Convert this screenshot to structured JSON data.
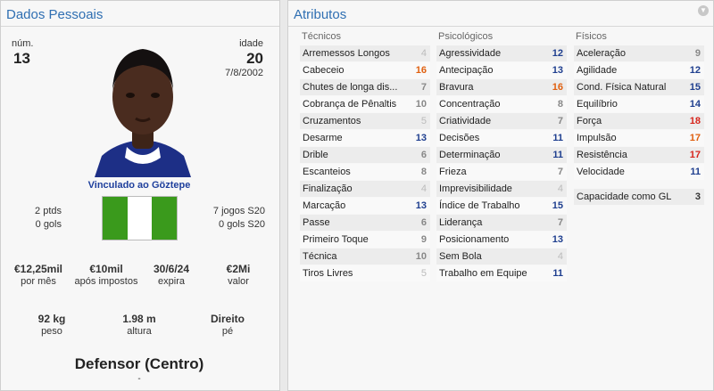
{
  "left": {
    "title": "Dados Pessoais",
    "num_label": "núm.",
    "num_value": "13",
    "age_label": "idade",
    "age_value": "20",
    "dob": "7/8/2002",
    "club_link": "Vinculado ao Göztepe",
    "stats_left": [
      "2 ptds",
      "0 gols"
    ],
    "stats_right": [
      "7 jogos S20",
      "0 gols S20"
    ],
    "contract": [
      {
        "value": "€12,25mil",
        "label": "por mês"
      },
      {
        "value": "€10mil",
        "label": "após impostos"
      },
      {
        "value": "30/6/24",
        "label": "expira"
      },
      {
        "value": "€2Mi",
        "label": "valor"
      }
    ],
    "physical": [
      {
        "value": "92 kg",
        "label": "peso"
      },
      {
        "value": "1.98 m",
        "label": "altura"
      },
      {
        "value": "Direito",
        "label": "pé"
      }
    ],
    "position": "Defensor (Centro)",
    "position_sub": "-",
    "flag_colors": [
      "#3a9a1c",
      "#ffffff",
      "#3a9a1c"
    ]
  },
  "right": {
    "title": "Atributos",
    "tecnicos": {
      "header": "Técnicos",
      "rows": [
        {
          "name": "Arremessos Longos",
          "value": "4",
          "style": "dim"
        },
        {
          "name": "Cabeceio",
          "value": "16",
          "style": "orange"
        },
        {
          "name": "Chutes de longa dis...",
          "value": "7",
          "style": "grey"
        },
        {
          "name": "Cobrança de Pênaltis",
          "value": "10",
          "style": "grey"
        },
        {
          "name": "Cruzamentos",
          "value": "5",
          "style": "dim"
        },
        {
          "name": "Desarme",
          "value": "13",
          "style": "blue"
        },
        {
          "name": "Drible",
          "value": "6",
          "style": "grey"
        },
        {
          "name": "Escanteios",
          "value": "8",
          "style": "grey"
        },
        {
          "name": "Finalização",
          "value": "4",
          "style": "dim"
        },
        {
          "name": "Marcação",
          "value": "13",
          "style": "blue"
        },
        {
          "name": "Passe",
          "value": "6",
          "style": "grey"
        },
        {
          "name": "Primeiro Toque",
          "value": "9",
          "style": "grey"
        },
        {
          "name": "Técnica",
          "value": "10",
          "style": "grey"
        },
        {
          "name": "Tiros Livres",
          "value": "5",
          "style": "dim"
        }
      ]
    },
    "psicologicos": {
      "header": "Psicológicos",
      "rows": [
        {
          "name": "Agressividade",
          "value": "12",
          "style": "blue"
        },
        {
          "name": "Antecipação",
          "value": "13",
          "style": "blue"
        },
        {
          "name": "Bravura",
          "value": "16",
          "style": "orange"
        },
        {
          "name": "Concentração",
          "value": "8",
          "style": "grey"
        },
        {
          "name": "Criatividade",
          "value": "7",
          "style": "grey"
        },
        {
          "name": "Decisões",
          "value": "11",
          "style": "blue"
        },
        {
          "name": "Determinação",
          "value": "11",
          "style": "blue"
        },
        {
          "name": "Frieza",
          "value": "7",
          "style": "grey"
        },
        {
          "name": "Imprevisibilidade",
          "value": "4",
          "style": "dim"
        },
        {
          "name": "Índice de Trabalho",
          "value": "15",
          "style": "blue"
        },
        {
          "name": "Liderança",
          "value": "7",
          "style": "grey"
        },
        {
          "name": "Posicionamento",
          "value": "13",
          "style": "blue"
        },
        {
          "name": "Sem Bola",
          "value": "4",
          "style": "dim"
        },
        {
          "name": "Trabalho em Equipe",
          "value": "11",
          "style": "blue"
        }
      ]
    },
    "fisicos": {
      "header": "Físicos",
      "rows": [
        {
          "name": "Aceleração",
          "value": "9",
          "style": "grey"
        },
        {
          "name": "Agilidade",
          "value": "12",
          "style": "blue"
        },
        {
          "name": "Cond. Física Natural",
          "value": "15",
          "style": "blue"
        },
        {
          "name": "Equilíbrio",
          "value": "14",
          "style": "blue"
        },
        {
          "name": "Força",
          "value": "18",
          "style": "red"
        },
        {
          "name": "Impulsão",
          "value": "17",
          "style": "orange"
        },
        {
          "name": "Resistência",
          "value": "17",
          "style": "red"
        },
        {
          "name": "Velocidade",
          "value": "11",
          "style": "blue"
        }
      ],
      "gk_label": "Capacidade como GL",
      "gk_value": "3"
    }
  }
}
